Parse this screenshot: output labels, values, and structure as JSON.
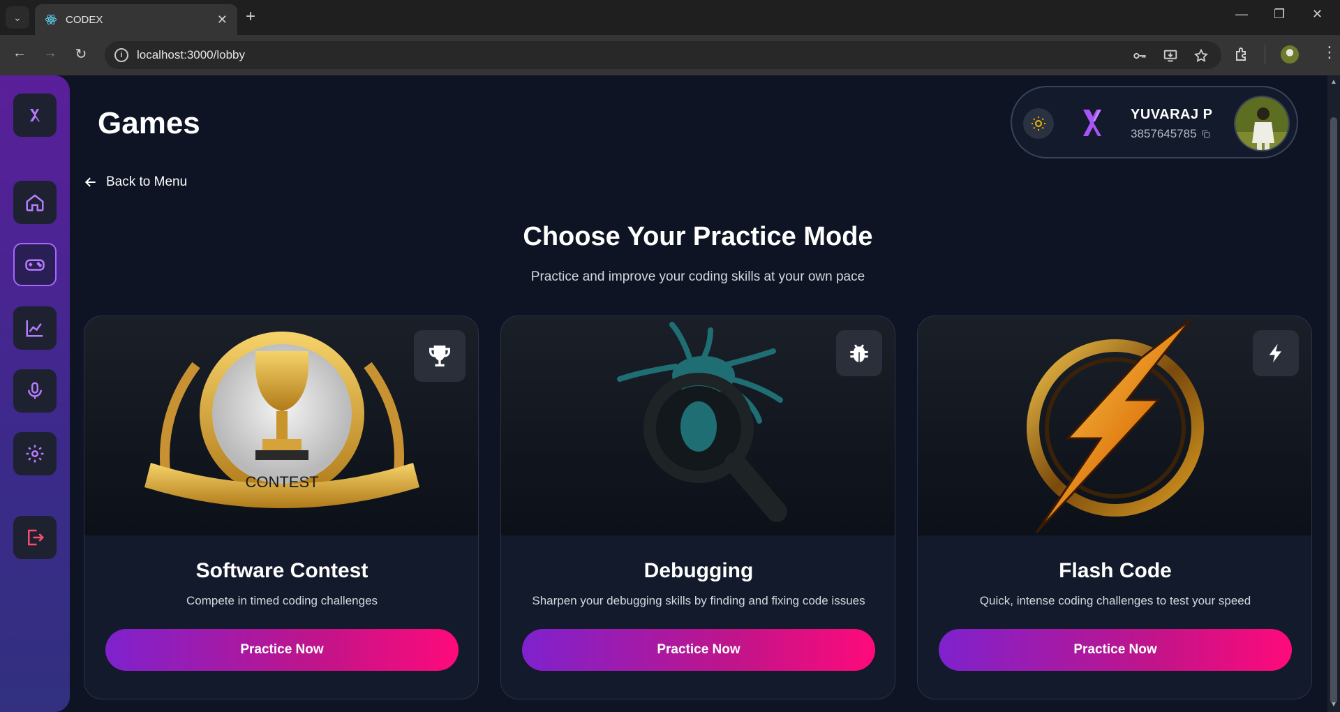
{
  "browser": {
    "tab_title": "CODEX",
    "url": "localhost:3000/lobby"
  },
  "header": {
    "page_title": "Games",
    "back_label": "Back to Menu"
  },
  "user": {
    "name": "YUVARAJ P",
    "id": "3857645785"
  },
  "section": {
    "title": "Choose Your Practice Mode",
    "subtitle": "Practice and improve your coding skills at your own pace"
  },
  "sidebar": {
    "items": [
      {
        "icon": "home-icon"
      },
      {
        "icon": "gamepad-icon",
        "active": true
      },
      {
        "icon": "chart-icon"
      },
      {
        "icon": "microphone-icon"
      },
      {
        "icon": "settings-icon"
      },
      {
        "icon": "logout-icon"
      }
    ]
  },
  "cards": [
    {
      "title": "Software Contest",
      "description": "Compete in timed coding challenges",
      "button": "Practice Now",
      "badge_icon": "trophy-icon",
      "media_caption": "CONTEST"
    },
    {
      "title": "Debugging",
      "description": "Sharpen your debugging skills by finding and fixing code issues",
      "button": "Practice Now",
      "badge_icon": "bug-icon"
    },
    {
      "title": "Flash Code",
      "description": "Quick, intense coding challenges to test your speed",
      "button": "Practice Now",
      "badge_icon": "bolt-icon"
    }
  ],
  "colors": {
    "accent_purple": "#a866ff",
    "button_gradient_start": "#7e22ce",
    "button_gradient_end": "#ff0a7a",
    "background": "#0e1424"
  }
}
